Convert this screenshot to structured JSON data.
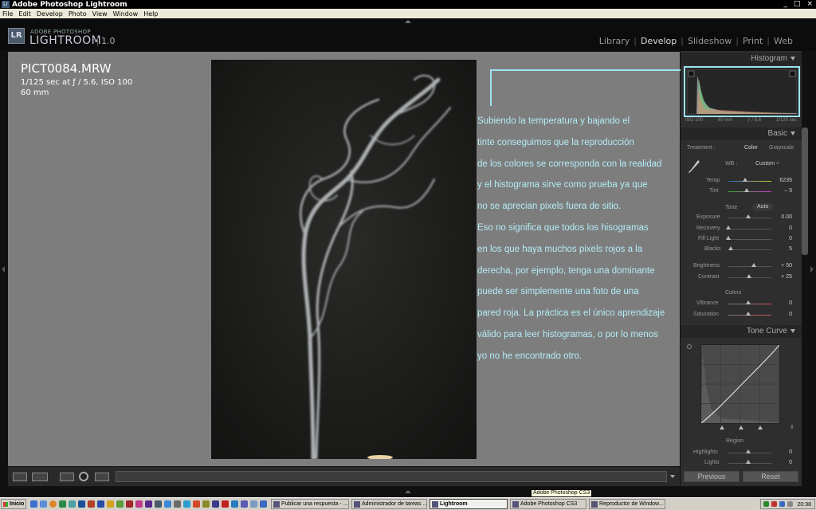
{
  "window": {
    "title": "Adobe Photoshop Lightroom",
    "controls": [
      "_",
      "□",
      "×"
    ]
  },
  "menu": [
    "File",
    "Edit",
    "Develop",
    "Photo",
    "View",
    "Window",
    "Help"
  ],
  "logo": {
    "small": "ADOBE PHOTOSHOP",
    "big": "LIGHTROOM",
    "version": "1.0",
    "badge": "LR"
  },
  "modules": [
    "Library",
    "Develop",
    "Slideshow",
    "Print",
    "Web"
  ],
  "active_module": "Develop",
  "photo_info": {
    "filename": "PICT0084.MRW",
    "exposure": "1/125 sec at ƒ / 5.6, ISO 100",
    "focal": "60 mm"
  },
  "annotation": {
    "lines": [
      "Subiendo la temperatura y bajando el",
      "tinte conseguimos que la reproducción",
      "de los colores se corresponda con la realidad",
      "y el histograma sirve como prueba ya que",
      "no se aprecian pixels fuera de sitio.",
      "Eso no significa que todos los hisogramas",
      "en los que haya muchos pixels rojos a la",
      "derecha, por ejemplo, tenga una dominante",
      "puede ser simplemente una foto de una",
      "pared roja. La práctica es el único aprendizaje",
      "válido para leer histogramas, o por lo menos",
      "yo no he encontrado otro."
    ],
    "color": "#b3ecf7"
  },
  "panel": {
    "histogram": {
      "title": "Histogram",
      "stats": [
        "ISO 100",
        "60 mm",
        "ƒ / 5.6",
        "1/125 sec"
      ]
    },
    "basic": {
      "title": "Basic",
      "treatment_label": "Treatment :",
      "treatment_options": [
        "Color",
        "Grayscale"
      ],
      "wb_label": "WB :",
      "wb_value": "Custom ÷",
      "temp": {
        "label": "Temp",
        "value": "6235",
        "level": 0.5
      },
      "tint": {
        "label": "Tint",
        "value": "– 9",
        "level": 0.48
      },
      "tone_label": "Tone",
      "auto_label": "Auto",
      "exposure": {
        "label": "Exposure",
        "value": "0.00",
        "level": 0.5
      },
      "recovery": {
        "label": "Recovery",
        "value": "0",
        "level": 0.0
      },
      "fill_light": {
        "label": "Fill Light",
        "value": "0",
        "level": 0.0
      },
      "blacks": {
        "label": "Blacks",
        "value": "5",
        "level": 0.05
      },
      "brightness": {
        "label": "Brightness",
        "value": "+ 50",
        "level": 0.62
      },
      "contrast": {
        "label": "Contrast",
        "value": "+ 25",
        "level": 0.56
      },
      "colors_label": "Colors",
      "vibrance": {
        "label": "Vibrance",
        "value": "0",
        "level": 0.5
      },
      "saturation": {
        "label": "Saturation",
        "value": "0",
        "level": 0.5
      }
    },
    "tone_curve": {
      "title": "Tone Curve",
      "region_label": "Region",
      "highlights": {
        "label": "Highlights",
        "value": "0",
        "level": 0.5
      },
      "lights": {
        "label": "Lights",
        "value": "0",
        "level": 0.5
      }
    },
    "previous_label": "Previous",
    "reset_label": "Reset"
  },
  "taskbar": {
    "start": "Inicio",
    "tasks": [
      "Publicar una respuesta - ...",
      "Administrador de tareas ...",
      "Lightroom",
      "Adobe Photoshop CS3",
      "Reproductor de Window..."
    ],
    "active_task": "Lightroom",
    "tooltip": "Adobe Photoshop CS3",
    "clock": "20:38"
  }
}
